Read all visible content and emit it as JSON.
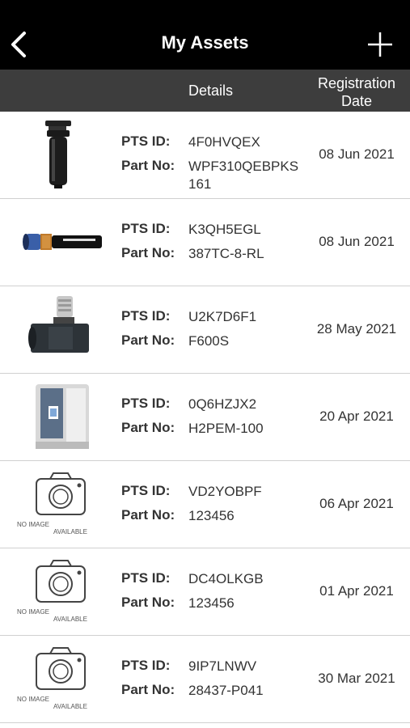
{
  "header": {
    "title": "My Assets",
    "back_icon": "back-chevron-icon",
    "add_icon": "plus-icon"
  },
  "columns": {
    "details": "Details",
    "registration_date": "Registration Date"
  },
  "labels": {
    "pts_id": "PTS ID:",
    "part_no": "Part No:"
  },
  "assets": [
    {
      "image": "filter-housing",
      "pts_id": "4F0HVQEX",
      "part_no": "WPF310QEBPKS161",
      "date": "08 Jun 2021"
    },
    {
      "image": "hydraulic-hose",
      "pts_id": "K3QH5EGL",
      "part_no": "387TC-8-RL",
      "date": "08 Jun 2021"
    },
    {
      "image": "flow-valve",
      "pts_id": "U2K7D6F1",
      "part_no": "F600S",
      "date": "28 May 2021"
    },
    {
      "image": "hydrogen-generator",
      "pts_id": "0Q6HZJX2",
      "part_no": "H2PEM-100",
      "date": "20 Apr 2021"
    },
    {
      "image": "no-image",
      "pts_id": "VD2YOBPF",
      "part_no": "123456",
      "date": "06 Apr 2021"
    },
    {
      "image": "no-image",
      "pts_id": "DC4OLKGB",
      "part_no": "123456",
      "date": "01 Apr 2021"
    },
    {
      "image": "no-image",
      "pts_id": "9IP7LNWV",
      "part_no": "28437-P041",
      "date": "30 Mar 2021"
    }
  ],
  "no_image_text": {
    "line1": "NO IMAGE",
    "line2": "AVAILABLE"
  }
}
